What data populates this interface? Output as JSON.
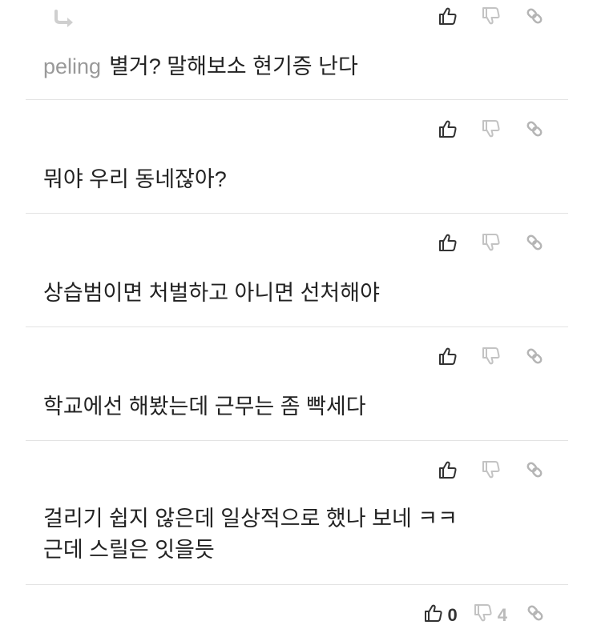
{
  "icons": {
    "upvote": "thumbs-up-icon",
    "downvote": "thumbs-down-icon",
    "permalink": "link-icon",
    "reply": "reply-arrow-icon"
  },
  "colors": {
    "text": "#222222",
    "username": "#999999",
    "divider": "#e3e3e3",
    "icon_active": "#333333",
    "icon_muted": "#bbbbbb"
  },
  "comments": [
    {
      "user": "peling",
      "text": "별거? 말해보소 현기증 난다"
    },
    {
      "text": "뭐야 우리 동네잖아?"
    },
    {
      "text": "상습범이면 처벌하고 아니면 선처해야"
    },
    {
      "text": "학교에선 해봤는데 근무는 좀 빡세다"
    },
    {
      "text_line1": "걸리기 쉽지 않은데 일상적으로 했나 보네 ㅋㅋ",
      "text_line2": "근데 스릴은 잇을듯"
    }
  ],
  "post_votes": {
    "up": "0",
    "down": "4"
  }
}
